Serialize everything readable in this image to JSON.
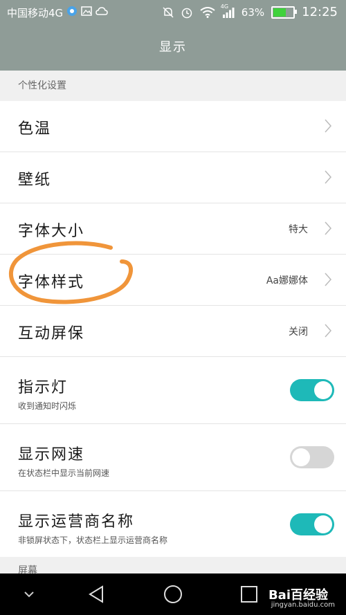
{
  "status_bar": {
    "carrier": "中国移动4G",
    "network_badge": "4G",
    "battery_percent": "63%",
    "battery_level": 0.63,
    "time": "12:25",
    "icons": [
      "bubble-icon",
      "image-icon",
      "weather-icon",
      "silent-icon",
      "alarm-icon",
      "wifi-icon",
      "signal-icon",
      "battery-icon"
    ]
  },
  "header": {
    "title": "显示"
  },
  "sections": [
    {
      "title": "个性化设置"
    },
    {
      "title": "屏幕"
    }
  ],
  "rows": [
    {
      "label": "色温"
    },
    {
      "label": "壁纸"
    },
    {
      "label": "字体大小",
      "value": "特大"
    },
    {
      "label": "字体样式",
      "value": "Aa娜娜体"
    },
    {
      "label": "互动屏保",
      "value": "关闭"
    },
    {
      "label": "指示灯",
      "sub": "收到通知时闪烁",
      "toggle": true
    },
    {
      "label": "显示网速",
      "sub": "在状态栏中显示当前网速",
      "toggle": false
    },
    {
      "label": "显示运营商名称",
      "sub": "非锁屏状态下，状态栏上显示运营商名称",
      "toggle": true
    }
  ],
  "colors": {
    "accent": "#1eb9b8",
    "header": "#8f9c97",
    "annotation": "#f0953a"
  },
  "watermark": {
    "brand": "Bai百经验",
    "url": "jingyan.baidu.com"
  },
  "nav": {
    "icons": [
      "chevron-down-icon",
      "back-icon",
      "home-icon",
      "recents-icon"
    ]
  }
}
